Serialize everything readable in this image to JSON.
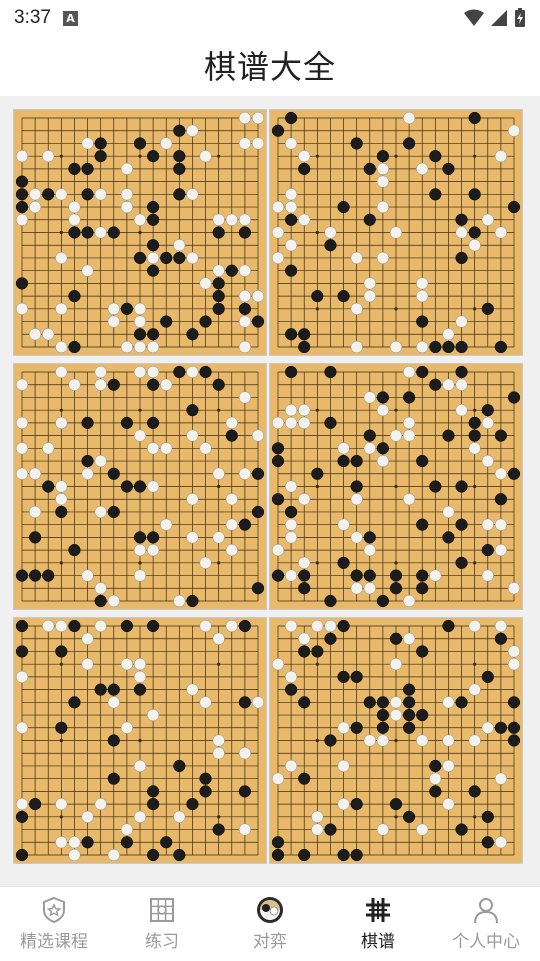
{
  "status_bar": {
    "time": "3:37",
    "notification_badge": "A"
  },
  "header": {
    "title": "棋谱大全"
  },
  "boards": [
    {
      "id": 1
    },
    {
      "id": 2
    },
    {
      "id": 3
    },
    {
      "id": 4
    },
    {
      "id": 5
    },
    {
      "id": 6
    }
  ],
  "tabs": [
    {
      "label": "精选课程",
      "icon": "shield-star-icon",
      "active": false
    },
    {
      "label": "练习",
      "icon": "practice-board-icon",
      "active": false
    },
    {
      "label": "对弈",
      "icon": "go-stones-icon",
      "active": false
    },
    {
      "label": "棋谱",
      "icon": "grid-hash-icon",
      "active": true
    },
    {
      "label": "个人中心",
      "icon": "user-icon",
      "active": false
    }
  ],
  "colors": {
    "board": "#e8b96a",
    "grid": "#3a2a10",
    "accent": "#222222",
    "inactive": "#9a9a9a"
  }
}
